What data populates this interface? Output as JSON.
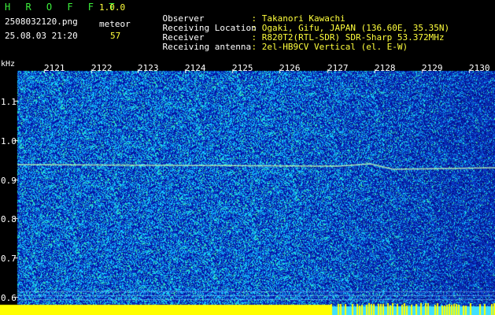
{
  "header": {
    "app_name": "H R O F F T",
    "version": "1.0.0",
    "filename": "2508032120.png",
    "datetime": "25.08.03 21:20",
    "count_label": "meteor",
    "count_value": "57",
    "fields": [
      {
        "label": "Observer",
        "value": ": Takanori Kawachi"
      },
      {
        "label": "Receiving Location",
        "value": ": Ogaki, Gifu, JAPAN (136.60E, 35.35N)"
      },
      {
        "label": "Receiver",
        "value": ": R820T2(RTL-SDR) SDR-Sharp 53.372MHz"
      },
      {
        "label": "Receiving antenna",
        "value": ": 2el-HB9CV Vertical (el. E-W)"
      }
    ]
  },
  "axes": {
    "y_unit": "kHz",
    "x_ticks": [
      "2121",
      "2122",
      "2123",
      "2124",
      "2125",
      "2126",
      "2127",
      "2128",
      "2129",
      "2130"
    ],
    "y_ticks": [
      "1.1",
      "1.0",
      "0.9",
      "0.8",
      "0.7",
      "0.6"
    ]
  },
  "colors": {
    "background": "#000000",
    "spectrum_base": "#0a1aa0",
    "noise_light": "#1ec8ff",
    "noise_green": "#3cf0a0",
    "bottom_band": "#ffff00"
  }
}
